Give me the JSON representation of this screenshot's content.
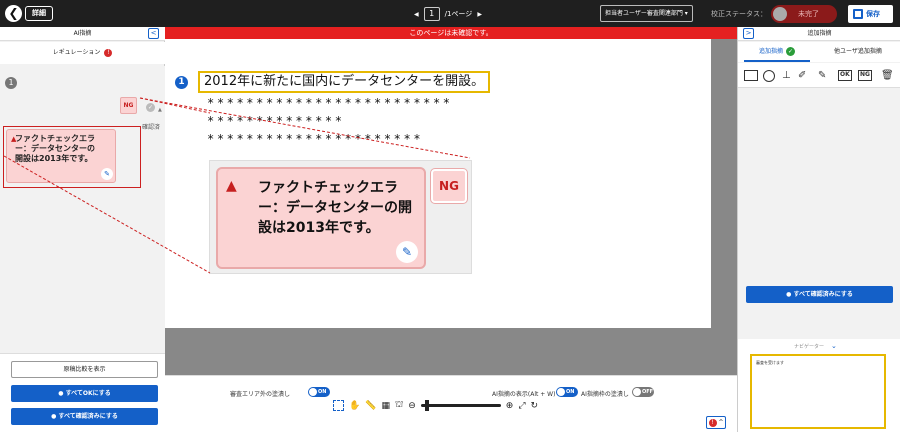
{
  "topbar": {
    "back_icon": "back-arrow-icon",
    "detail_label": "詳細",
    "page_current": "1",
    "page_total": "/1ページ",
    "prev_arrow": "◀",
    "next_arrow": "▶",
    "department": "担当者ユーザー審査関連部門",
    "status_label": "校正ステータス：",
    "status_value": "未完了",
    "save_label": "保存"
  },
  "left_panel": {
    "title": "AI指摘",
    "collapse_glyph": "<",
    "regulation_label": "レギュレーション",
    "regulation_alert": "!",
    "item_number": "1",
    "card_text": "ファクトチェックエラー：データセンターの開設は2013年です。",
    "ng_label": "NG",
    "check_label": "確認済",
    "compare_button": "原稿比較を表示",
    "ok_all_button": "すべてOKにする",
    "confirm_all_button": "すべて確認済みにする"
  },
  "center": {
    "banner": "このページは未確認です。",
    "item_number": "1",
    "highlight_text": "2012年に新たに国内にデータセンターを開設。",
    "masked_lines": [
      "*************************",
      "**************",
      "**********************"
    ],
    "zoom_card_text": "ファクトチェックエラー：データセンターの開設は2013年です。",
    "zoom_ng": "NG",
    "bottom": {
      "review_outside_label": "審査エリア外の塗潰し",
      "review_outside_toggle": "ON",
      "ai_display_label": "AI指摘の表示(Alt + W)",
      "ai_display_toggle": "ON",
      "ai_frame_label": "AI指摘枠の塗潰し",
      "ai_frame_toggle": "OFF",
      "alert_count": "!"
    }
  },
  "right_panel": {
    "title": "追加指摘",
    "collapse_glyph": ">",
    "tab_add": "追加指摘",
    "tab_other": "他ユーザ追加指摘",
    "tool_ok": "OK",
    "tool_ng": "NG",
    "confirm_all_button": "すべて確認済みにする",
    "navigator_label": "ナビゲーター",
    "thumb_text": "審査を受けます"
  },
  "colors": {
    "accent_blue": "#1460c8",
    "alert_red": "#e52020",
    "highlight_yellow": "#e6b800",
    "error_pink": "#fbd3d3"
  }
}
